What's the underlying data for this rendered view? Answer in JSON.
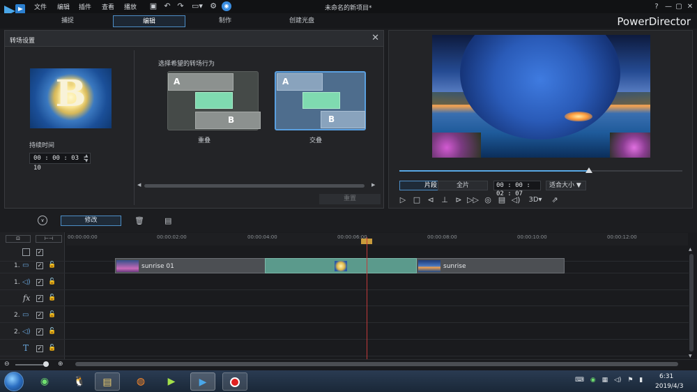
{
  "menu": [
    "文件",
    "编辑",
    "插件",
    "查看",
    "播放"
  ],
  "toolbar_icons": [
    "save-icon",
    "undo-icon",
    "redo-icon",
    "screen-mode-icon",
    "settings-gear-icon",
    "profile-badge-icon"
  ],
  "window": {
    "title": "未命名的新项目*",
    "help": "?",
    "minimize": "—",
    "restore": "▢",
    "close": "✕"
  },
  "tabs": [
    {
      "label": "捕捉"
    },
    {
      "label": "编辑",
      "active": true
    },
    {
      "label": "制作"
    },
    {
      "label": "创建光盘"
    }
  ],
  "brand": "PowerDirector",
  "dialog": {
    "title": "转场设置",
    "duration_label": "持续时间",
    "duration_value": "00 : 00 : 03 : 10",
    "choose_label": "选择希望的转场行为",
    "options": [
      {
        "label": "重叠",
        "a": "A",
        "b": "B"
      },
      {
        "label": "交叠",
        "a": "A",
        "b": "B",
        "selected": true
      }
    ],
    "thumb_letter": "B",
    "ok_label": "重置"
  },
  "preview": {
    "seek_position": 0.67,
    "clip_btn": "片段",
    "full_btn": "全片",
    "time": "00 : 00 : 02 : 07",
    "fit": "适合大小",
    "mode3d": "3D"
  },
  "playback_icons": [
    "play-icon",
    "stop-icon",
    "prev-frame-icon",
    "mark-icon",
    "next-frame-icon",
    "fast-forward-icon",
    "snapshot-icon",
    "subtitle-icon",
    "volume-icon"
  ],
  "timeline": {
    "modify_label": "修改",
    "ticks": [
      "00:00:00:00",
      "00:00:02:00",
      "00:00:04:00",
      "00:00:06:00",
      "00:00:08:00",
      "00:00:10:00",
      "00:00:12:00"
    ],
    "tracks": [
      {
        "num": "",
        "icon": "select-all-icon"
      },
      {
        "num": "1.",
        "icon": "video-track-icon"
      },
      {
        "num": "1.",
        "icon": "audio-track-icon"
      },
      {
        "num": "",
        "icon": "fx-track-icon",
        "glyph": "fx"
      },
      {
        "num": "2.",
        "icon": "video-track-icon"
      },
      {
        "num": "2.",
        "icon": "audio-track-icon"
      },
      {
        "num": "",
        "icon": "title-track-icon",
        "glyph": "T"
      }
    ],
    "clips": [
      {
        "label": "sunrise 01"
      },
      {
        "label": "sunrise"
      }
    ]
  },
  "taskbar": {
    "time": "6:31",
    "date": "2019/4/3"
  }
}
